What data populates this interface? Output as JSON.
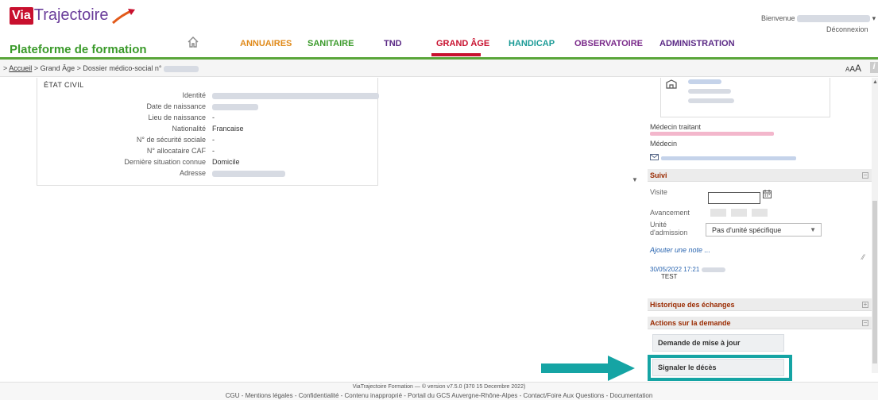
{
  "brand": {
    "logo_via": "Via",
    "logo_trajectoire": "Trajectoire",
    "platform_name": "Plateforme de formation"
  },
  "user": {
    "welcome": "Bienvenue",
    "logout": "Déconnexion"
  },
  "nav": {
    "items": [
      {
        "label": "ANNUAIRES",
        "color": "#e08a1a",
        "active": false
      },
      {
        "label": "SANITAIRE",
        "color": "#3a9a2a",
        "active": false
      },
      {
        "label": "TND",
        "color": "#5b2a86",
        "active": false
      },
      {
        "label": "GRAND ÂGE",
        "color": "#c8102e",
        "active": true
      },
      {
        "label": "HANDICAP",
        "color": "#1a9a96",
        "active": false
      },
      {
        "label": "OBSERVATOIRE",
        "color": "#7a2a8a",
        "active": false
      },
      {
        "label": "ADMINISTRATION",
        "color": "#5b2a86",
        "active": false
      }
    ]
  },
  "breadcrumb": {
    "prefix": ">",
    "home": "Accueil",
    "rest": "> Grand Âge > Dossier médico-social n°"
  },
  "font_size_control": "AAA",
  "etat_civil": {
    "title": "ÉTAT CIVIL",
    "fields": [
      {
        "label": "Identité",
        "value": ""
      },
      {
        "label": "Date de naissance",
        "value": ""
      },
      {
        "label": "Lieu de naissance",
        "value": "-"
      },
      {
        "label": "Nationalité",
        "value": "Francaise"
      },
      {
        "label": "N° de sécurité sociale",
        "value": "-"
      },
      {
        "label": "N° allocataire CAF",
        "value": "-"
      },
      {
        "label": "Dernière situation connue",
        "value": "Domicile"
      },
      {
        "label": "Adresse",
        "value": ""
      }
    ]
  },
  "contacts": {
    "medecin_traitant": "Médecin traitant",
    "medecin": "Médecin"
  },
  "suivi": {
    "title": "Suivi",
    "visite_label": "Visite",
    "avancement_label": "Avancement",
    "unite_label_1": "Unité",
    "unite_label_2": "d'admission",
    "unite_value": "Pas d'unité spécifique",
    "add_note": "Ajouter une note ...",
    "note_date": "30/05/2022 17:21",
    "note_text": "TEST"
  },
  "historique": {
    "title": "Historique des échanges"
  },
  "actions": {
    "title": "Actions sur la demande",
    "update_request": "Demande de mise à jour",
    "report_death": "Signaler le décès"
  },
  "footer": {
    "line1": "ViaTrajectoire Formation — © version v7.5.0 (370 15 Decembre 2022)",
    "line2": "CGU - Mentions légales - Confidentialité - Contenu inapproprié - Portail du GCS Auvergne-Rhône-Alpes  - Contact/Foire Aux Questions - Documentation"
  },
  "colors": {
    "accent_green": "#5aa63a",
    "accent_red": "#c8102e",
    "highlight_teal": "#15a4a4",
    "section_title": "#9a2a00"
  },
  "icons": [
    "home-icon",
    "address-icon",
    "mail-icon",
    "calendar-icon",
    "chevron-down-icon",
    "info-icon",
    "external-link-icon"
  ]
}
